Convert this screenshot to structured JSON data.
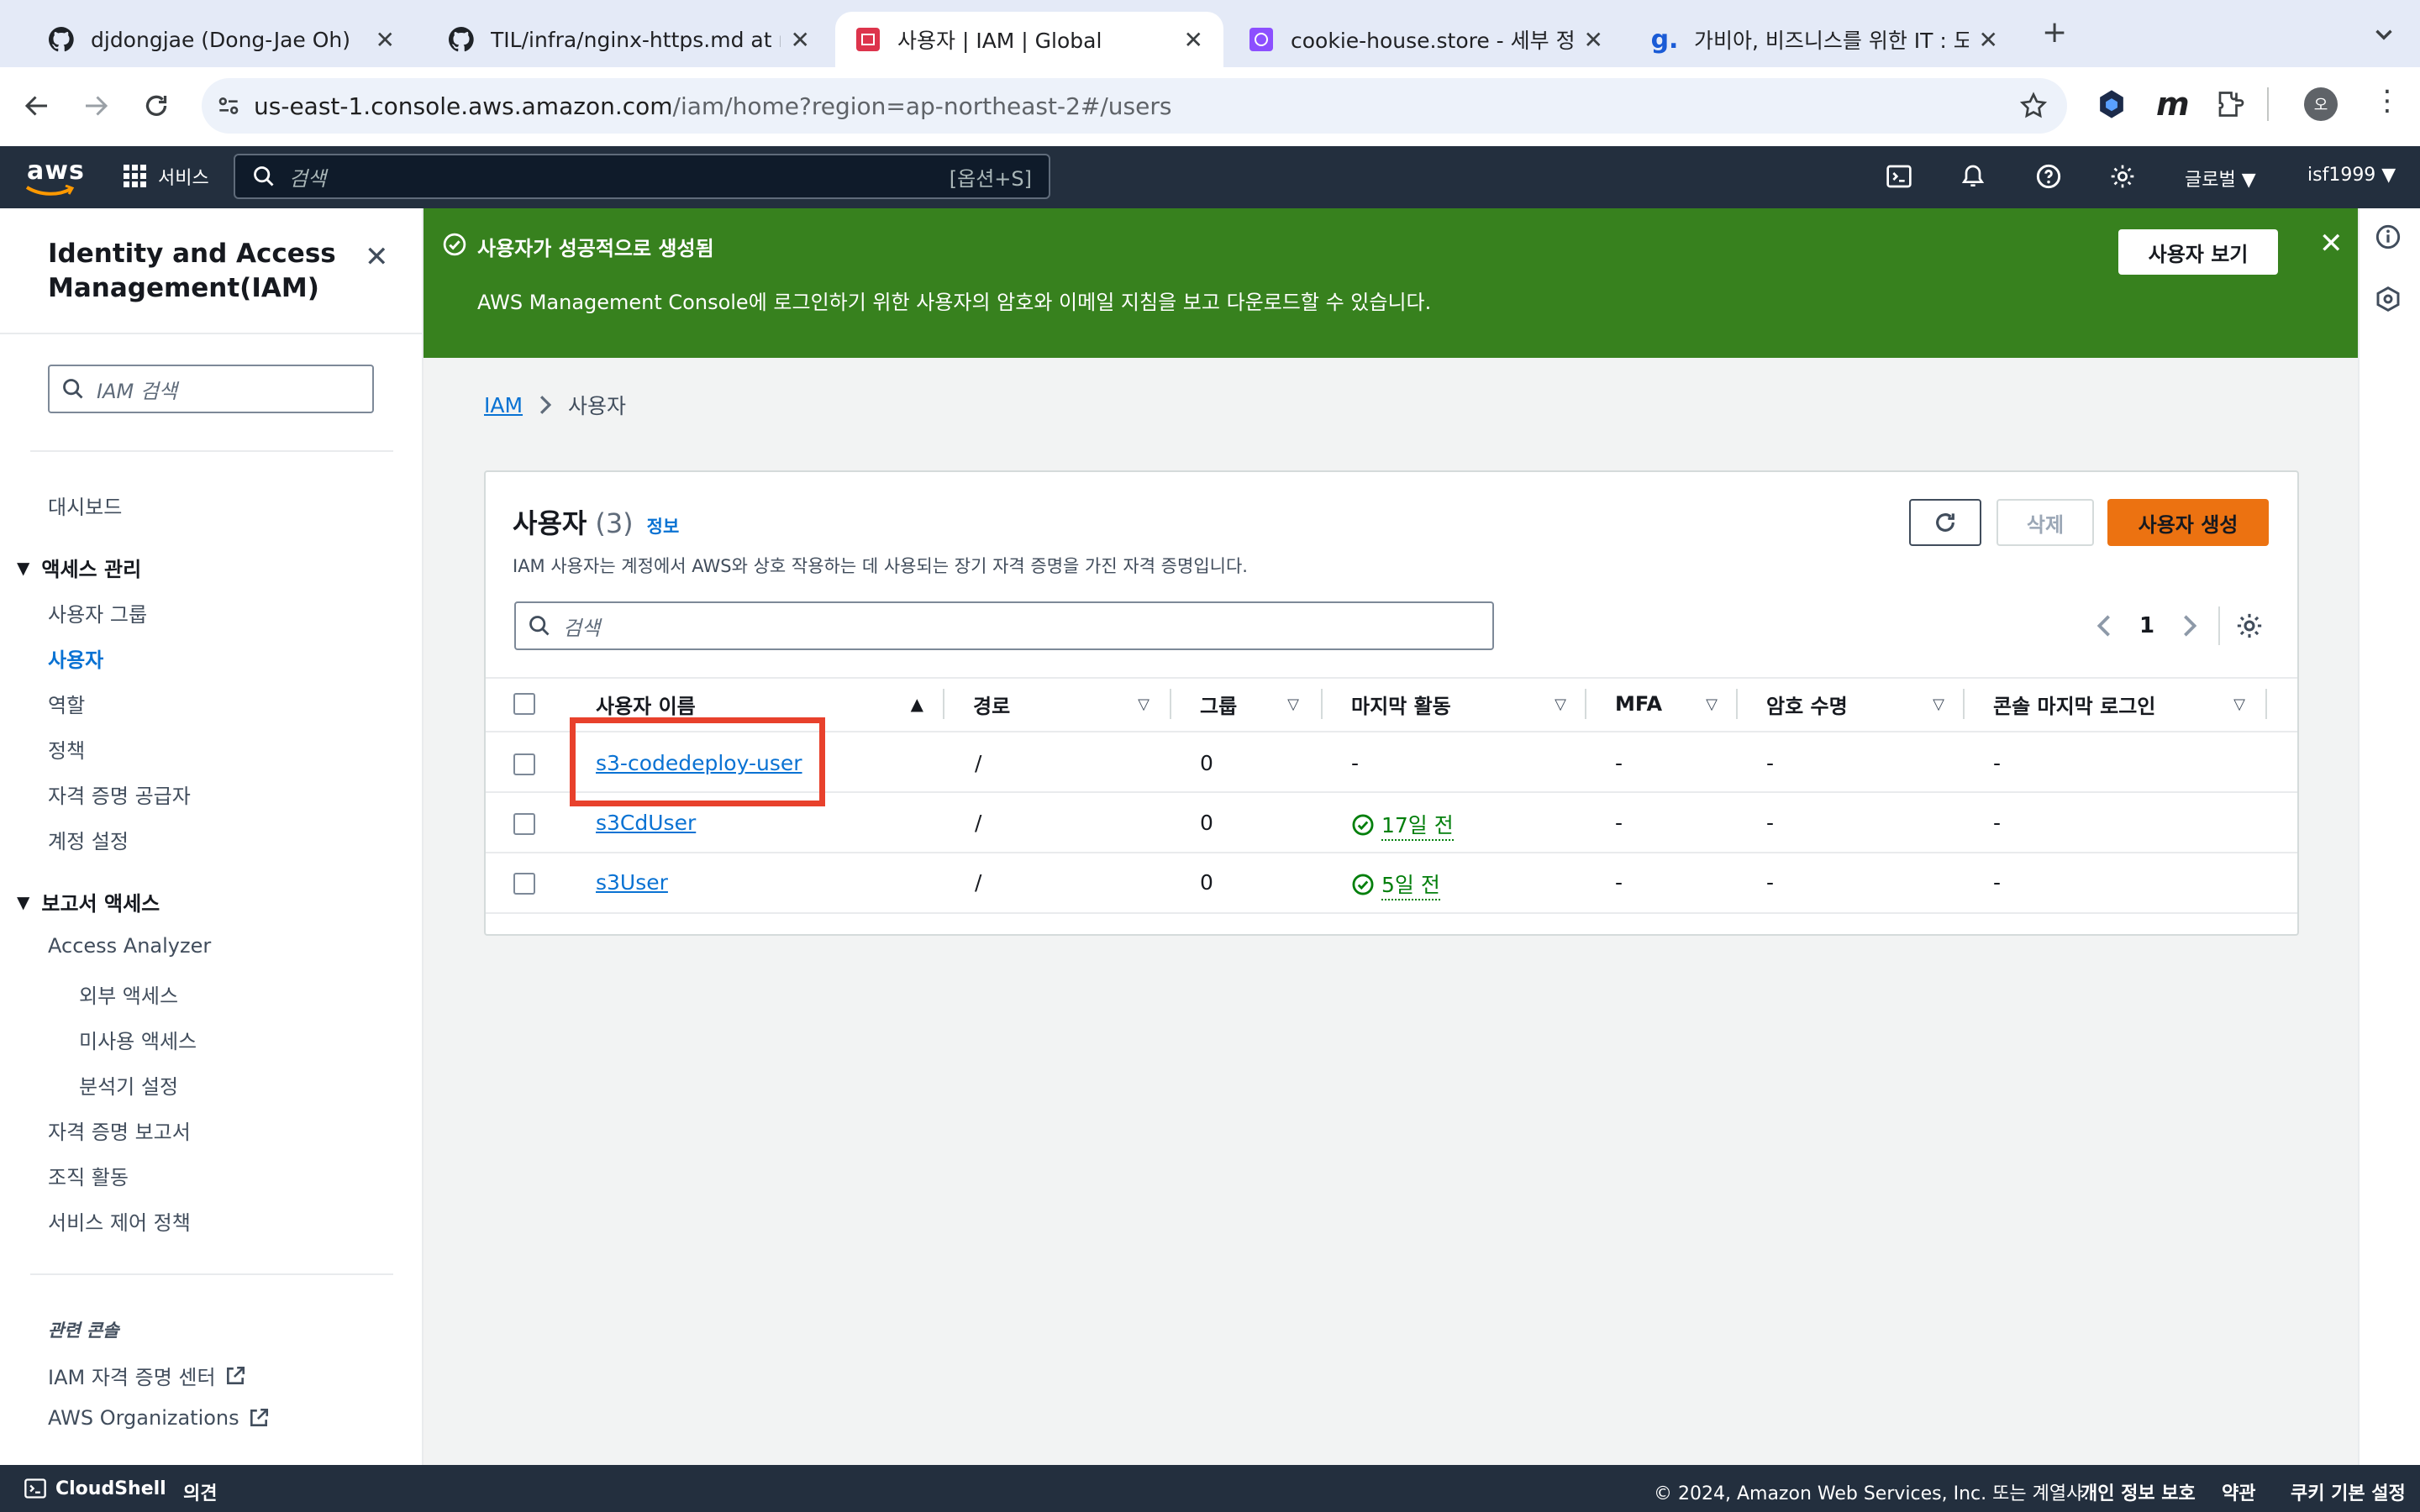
{
  "browser": {
    "tabs": [
      {
        "title": "djdongjae (Dong-Jae Oh)",
        "favicon": "github-icon",
        "active": false
      },
      {
        "title": "TIL/infra/nginx-https.md at m",
        "favicon": "github-icon",
        "active": false
      },
      {
        "title": "사용자 | IAM | Global",
        "favicon": "aws-iam-icon",
        "active": true
      },
      {
        "title": "cookie-house.store - 세부 정보",
        "favicon": "route53-icon",
        "active": false
      },
      {
        "title": "가비아, 비즈니스를 위한 IT : 도메인",
        "favicon": "gabia-icon",
        "active": false
      }
    ],
    "new_tab": "+",
    "url_host": "us-east-1.console.aws.amazon.com",
    "url_path": "/iam/home?region=ap-northeast-2#/users",
    "profile_initial": "오"
  },
  "aws_header": {
    "logo": "aws",
    "services_label": "서비스",
    "search_placeholder": "검색",
    "search_shortcut": "[옵션+S]",
    "region_label": "글로벌 ▼",
    "account_label": "isf1999 ▼"
  },
  "sidebar": {
    "title_line1": "Identity and Access",
    "title_line2": "Management(IAM)",
    "search_placeholder": "IAM 검색",
    "dashboard": "대시보드",
    "access_mgmt": "액세스 관리",
    "access_items": [
      "사용자 그룹",
      "사용자",
      "역할",
      "정책",
      "자격 증명 공급자",
      "계정 설정"
    ],
    "reports": "보고서 액세스",
    "reports_items": [
      "Access Analyzer",
      "외부 액세스",
      "미사용 액세스",
      "분석기 설정",
      "자격 증명 보고서",
      "조직 활동",
      "서비스 제어 정책"
    ],
    "related": "관련 콘솔",
    "related_items": [
      "IAM 자격 증명 센터",
      "AWS Organizations"
    ]
  },
  "flash": {
    "title": "사용자가 성공적으로 생성됨",
    "message": "AWS Management Console에 로그인하기 위한 사용자의 암호와 이메일 지침을 보고 다운로드할 수 있습니다.",
    "button": "사용자 보기"
  },
  "breadcrumb": {
    "root": "IAM",
    "current": "사용자"
  },
  "users_panel": {
    "heading": "사용자",
    "count": "(3)",
    "info": "정보",
    "description": "IAM 사용자는 계정에서 AWS와 상호 작용하는 데 사용되는 장기 자격 증명을 가진 자격 증명입니다.",
    "delete_button": "삭제",
    "create_button": "사용자 생성",
    "search_placeholder": "검색",
    "page": "1",
    "columns": [
      "사용자 이름",
      "경로",
      "그룹",
      "마지막 활동",
      "MFA",
      "암호 수명",
      "콘솔 마지막 로그인"
    ],
    "rows": [
      {
        "name": "s3-codedeploy-user",
        "path": "/",
        "groups": "0",
        "last_activity": "-",
        "activity_ok": false,
        "mfa": "-",
        "pwd_age": "-",
        "console_login": "-"
      },
      {
        "name": "s3CdUser",
        "path": "/",
        "groups": "0",
        "last_activity": "17일 전",
        "activity_ok": true,
        "mfa": "-",
        "pwd_age": "-",
        "console_login": "-"
      },
      {
        "name": "s3User",
        "path": "/",
        "groups": "0",
        "last_activity": "5일 전",
        "activity_ok": true,
        "mfa": "-",
        "pwd_age": "-",
        "console_login": "-"
      }
    ]
  },
  "footer": {
    "cloudshell": "CloudShell",
    "feedback": "의견",
    "copyright": "© 2024, Amazon Web Services, Inc. 또는 계열사.",
    "privacy": "개인 정보 보호",
    "terms": "약관",
    "cookies": "쿠키 기본 설정"
  },
  "colors": {
    "aws_nav": "#232f3e",
    "success": "#37811e",
    "primary_button": "#ec7211",
    "link": "#0972d3",
    "highlight_box": "#e8412c"
  }
}
